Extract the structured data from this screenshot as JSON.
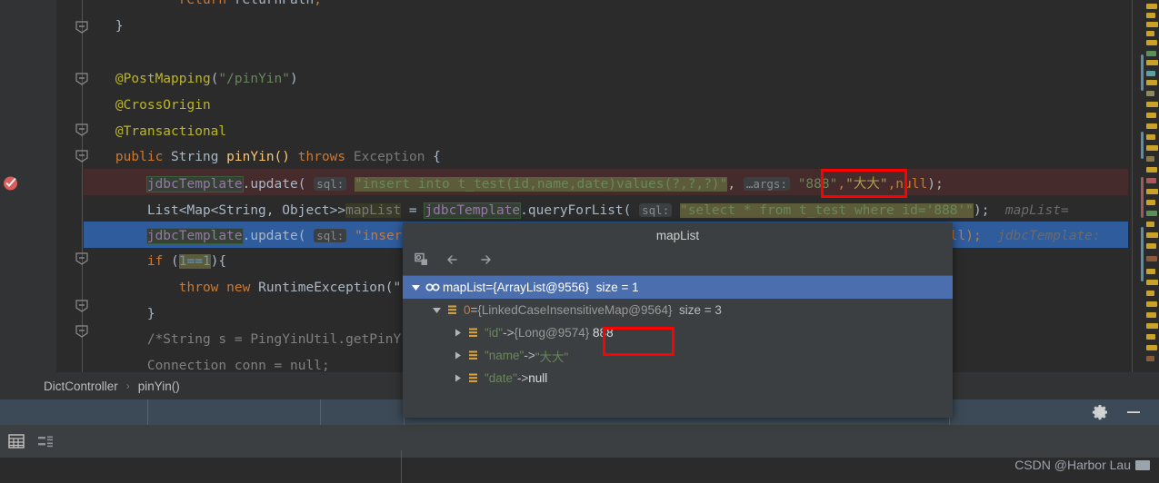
{
  "editor": {
    "lines": [
      {
        "id": "l0",
        "indent": "            ",
        "text": "return returnPath;"
      },
      {
        "id": "l1",
        "text": "    }"
      },
      {
        "id": "l2",
        "text": ""
      },
      {
        "id": "l3",
        "text": "    @PostMapping(\"/pinYin\")"
      },
      {
        "id": "l4",
        "text": "    @CrossOrigin"
      },
      {
        "id": "l5",
        "text": "    @Transactional"
      },
      {
        "id": "l6",
        "text": "    public String pinYin() throws Exception {"
      },
      {
        "id": "l7",
        "text": "        jdbcTemplate.update( sql: \"insert into t_test(id,name,date)values(?,?,?)\", …args: \"888\",\"大大\",null);"
      },
      {
        "id": "l8",
        "text": "        List<Map<String, Object>> mapList = jdbcTemplate.queryForList( sql: \"select * from t_test where id='888'\");  mapList="
      },
      {
        "id": "l9",
        "text": "        jdbcTemplate.update( sql: \"insert                                                                 ,null);  jdbcTemplate:"
      },
      {
        "id": "l10",
        "text": "        if (1==1){"
      },
      {
        "id": "l11",
        "text": "            throw new RuntimeException(\""
      },
      {
        "id": "l12",
        "text": "        }"
      },
      {
        "id": "l13",
        "text": "        /*String s = PingYinUtil.getPinY"
      },
      {
        "id": "l14",
        "text": "        Connection conn = null;"
      }
    ],
    "tokens": {
      "keyword_return": "return",
      "var_returnPath": "returnPath",
      "annotation_postmapping": "@PostMapping",
      "annotation_path": "\"/pinYin\"",
      "annotation_crossorigin": "@CrossOrigin",
      "annotation_transactional": "@Transactional",
      "kw_public": "public",
      "type_String": "String",
      "method_pinYin": "pinYin()",
      "kw_throws": "throws",
      "type_Exception": "Exception",
      "field_jdbcTemplate": "jdbcTemplate",
      "method_update": ".update(",
      "hint_sql": "sql:",
      "hint_args": "…args:",
      "sql_insert": "\"insert into t_test(id,name,date)values(?,?,?)\"",
      "arg_888": "\"888\"",
      "arg_daida": "\"大大\"",
      "arg_null": "null",
      "type_listmap": "List<Map<String, Object>>",
      "var_mapList": "mapList",
      "method_queryForList": ".queryForList(",
      "sql_select": "\"select * from t_test where id='888'\"",
      "inlay_mapList": "mapList=",
      "inlay_jdbcTemplate": "jdbcTemplate:",
      "kw_if": "if",
      "cond_1eq1": "1==1",
      "kw_throw": "throw",
      "kw_new": "new",
      "cls_RuntimeException": "RuntimeException(\"",
      "comment_pingyin": "/*String s = PingYinUtil.getPinY",
      "type_Connection": "Connection",
      "var_conn": "conn",
      "kw_null": "null",
      "sql_insert_short": "\"insert",
      "tail_null": ",null);"
    }
  },
  "breadcrumb": {
    "class": "DictController",
    "separator": "›",
    "method": "pinYin()"
  },
  "popup": {
    "title": "mapList",
    "toolbar": {
      "inspect": "inspect-icon",
      "back": "back-arrow-icon",
      "forward": "forward-arrow-icon"
    },
    "tree": [
      {
        "depth": 0,
        "twisty": "expanded",
        "icon": "watch-icon",
        "selected": true,
        "name": "mapList",
        "eq": " = ",
        "type": "{ArrayList@9556}",
        "size": "size = 1"
      },
      {
        "depth": 1,
        "twisty": "expanded",
        "icon": "map-entry-icon",
        "selected": false,
        "name": "0",
        "eq": " = ",
        "type": "{LinkedCaseInsensitiveMap@9564}",
        "size": "size = 3"
      },
      {
        "depth": 2,
        "twisty": "collapsed",
        "icon": "map-entry-icon",
        "selected": false,
        "key": "\"id\"",
        "arrow": " -> ",
        "type": "{Long@9574}",
        "value": "888"
      },
      {
        "depth": 2,
        "twisty": "collapsed",
        "icon": "map-entry-icon",
        "selected": false,
        "key": "\"name\"",
        "arrow": " -> ",
        "value": "\"大大\"",
        "valueClass": "tgreen"
      },
      {
        "depth": 2,
        "twisty": "collapsed",
        "icon": "map-entry-icon",
        "selected": false,
        "key": "\"date\"",
        "arrow": " -> ",
        "value": "null",
        "valueClass": "twhite"
      }
    ]
  },
  "bottom": {
    "gear": "gear-icon",
    "minimize": "minimize-icon",
    "table_icon": "table-view-icon",
    "list_icon": "list-view-icon",
    "watermark": "CSDN @Harbor Lau"
  },
  "annotations": {
    "box1": "red-highlight-args-888",
    "box2": "red-highlight-tree-888"
  },
  "colors": {
    "editor_bg": "#2b2b2b",
    "gutter_bg": "#313335",
    "panel_bg": "#3c3f41",
    "selection_blue": "#2f5c9c",
    "exec_line": "#452b2b",
    "tree_selected": "#4b6eaf",
    "tab_strip": "#3c4a57",
    "keyword": "#cc7832",
    "string": "#6a8759",
    "annotation": "#bbb529",
    "number": "#6897bb",
    "field": "#9876aa",
    "text": "#a9b7c6",
    "accent_red": "#ff0000"
  }
}
